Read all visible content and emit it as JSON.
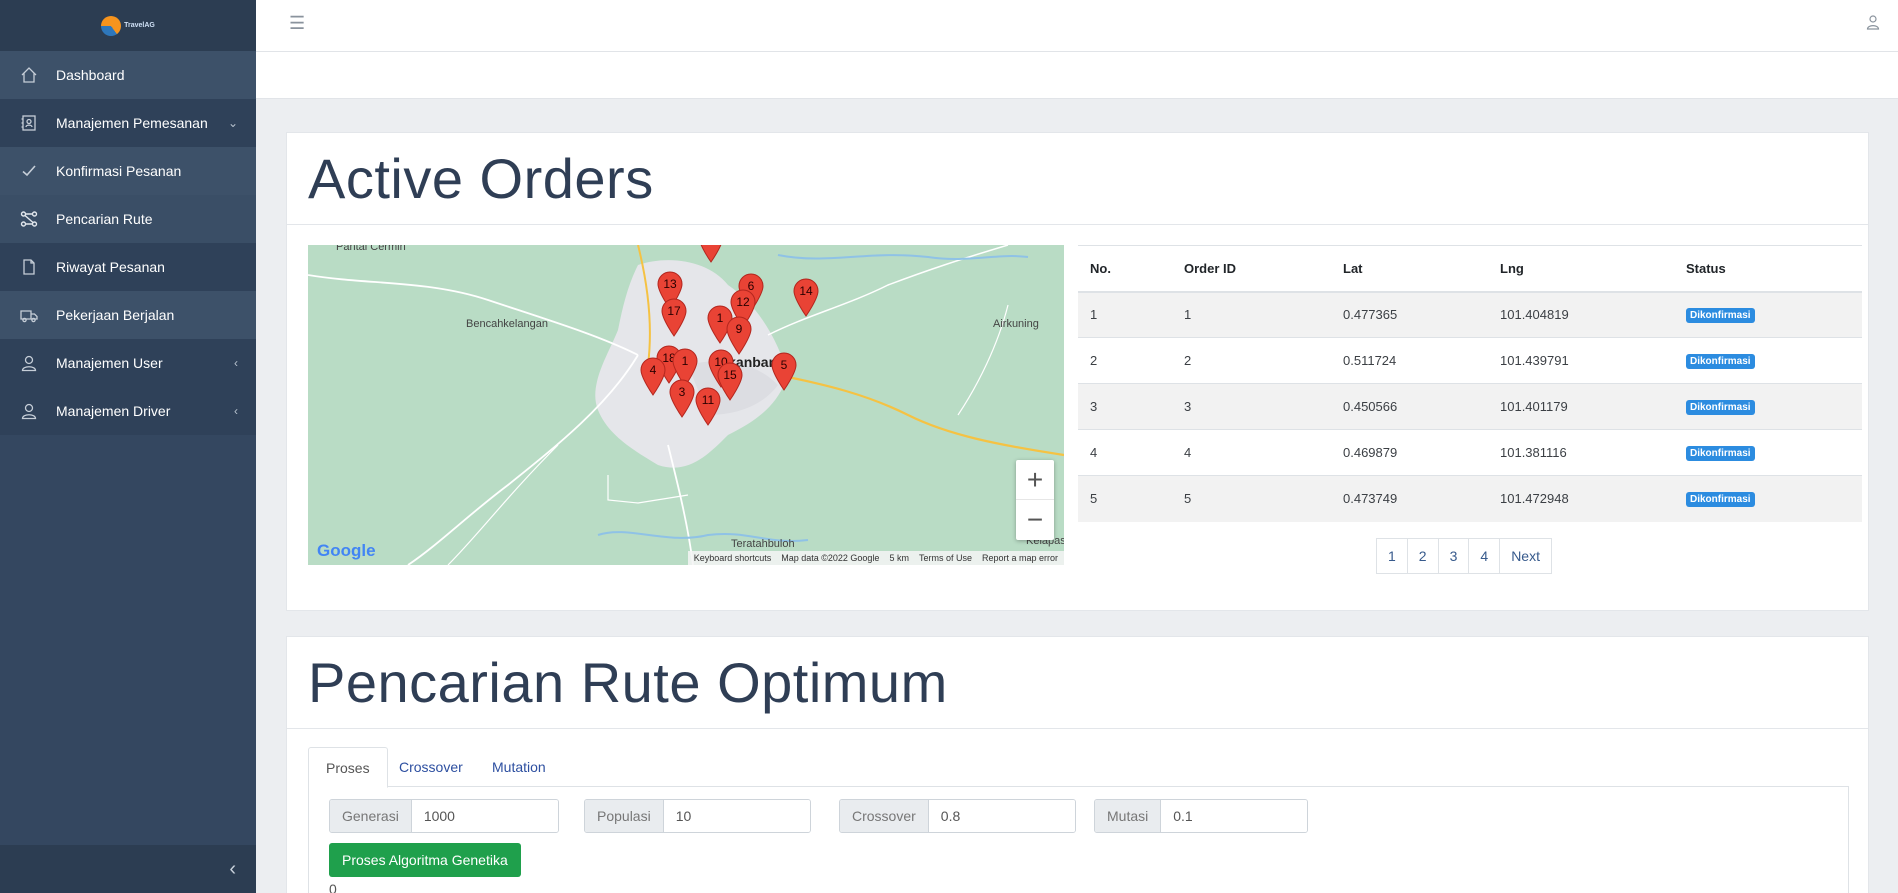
{
  "brand": {
    "logo_text": "TravelAG"
  },
  "sidebar": {
    "items": [
      {
        "label": "Dashboard",
        "icon": "home-icon",
        "arrow": ""
      },
      {
        "label": "Manajemen Pemesanan",
        "icon": "contact-book-icon",
        "arrow": "⌄"
      },
      {
        "label": "Konfirmasi Pesanan",
        "icon": "check-icon",
        "arrow": ""
      },
      {
        "label": "Pencarian Rute",
        "icon": "route-icon",
        "arrow": ""
      },
      {
        "label": "Riwayat Pesanan",
        "icon": "file-icon",
        "arrow": ""
      },
      {
        "label": "Pekerjaan Berjalan",
        "icon": "truck-icon",
        "arrow": ""
      },
      {
        "label": "Manajemen User",
        "icon": "user-icon",
        "arrow": "‹"
      },
      {
        "label": "Manajemen Driver",
        "icon": "user-icon",
        "arrow": "‹"
      }
    ],
    "collapse_icon": "‹"
  },
  "header": {
    "menu_icon": "☰"
  },
  "active_orders": {
    "title": "Active Orders",
    "map": {
      "places": [
        "Pantai Cermin",
        "Bencahkelangan",
        "Airkuning",
        "Pekanbaru",
        "Teratahbuloh",
        "Kelapas"
      ],
      "markers": [
        "13",
        "6",
        "14",
        "12",
        "17",
        "1",
        "9",
        "18",
        "1",
        "10",
        "4",
        "15",
        "5",
        "3",
        "11"
      ],
      "zoom_in": "+",
      "zoom_out": "−",
      "google": "Google",
      "attribution": [
        "Keyboard shortcuts",
        "Map data ©2022 Google",
        "5 km",
        "Terms of Use",
        "Report a map error"
      ]
    },
    "table": {
      "headers": [
        "No.",
        "Order ID",
        "Lat",
        "Lng",
        "Status"
      ],
      "rows": [
        {
          "no": "1",
          "id": "1",
          "lat": "0.477365",
          "lng": "101.404819",
          "status": "Dikonfirmasi"
        },
        {
          "no": "2",
          "id": "2",
          "lat": "0.511724",
          "lng": "101.439791",
          "status": "Dikonfirmasi"
        },
        {
          "no": "3",
          "id": "3",
          "lat": "0.450566",
          "lng": "101.401179",
          "status": "Dikonfirmasi"
        },
        {
          "no": "4",
          "id": "4",
          "lat": "0.469879",
          "lng": "101.381116",
          "status": "Dikonfirmasi"
        },
        {
          "no": "5",
          "id": "5",
          "lat": "0.473749",
          "lng": "101.472948",
          "status": "Dikonfirmasi"
        }
      ]
    },
    "pagination": [
      "1",
      "2",
      "3",
      "4",
      "Next"
    ]
  },
  "route_search": {
    "title": "Pencarian Rute Optimum",
    "tabs": [
      "Proses",
      "Crossover",
      "Mutation"
    ],
    "inputs": [
      {
        "label": "Generasi",
        "value": "1000"
      },
      {
        "label": "Populasi",
        "value": "10"
      },
      {
        "label": "Crossover",
        "value": "0.8"
      },
      {
        "label": "Mutasi",
        "value": "0.1"
      }
    ],
    "run_button": "Proses Algoritma Genetika",
    "result": "0"
  }
}
